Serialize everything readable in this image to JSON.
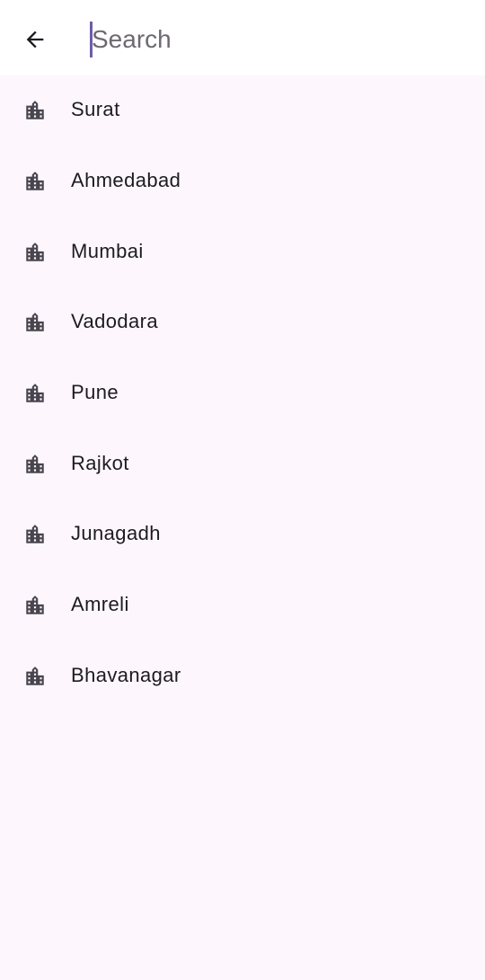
{
  "search": {
    "placeholder": "Search",
    "value": ""
  },
  "results": [
    {
      "label": "Surat",
      "icon": "city-icon"
    },
    {
      "label": "Ahmedabad",
      "icon": "city-icon"
    },
    {
      "label": "Mumbai",
      "icon": "city-icon"
    },
    {
      "label": "Vadodara",
      "icon": "city-icon"
    },
    {
      "label": "Pune",
      "icon": "city-icon"
    },
    {
      "label": "Rajkot",
      "icon": "city-icon"
    },
    {
      "label": "Junagadh",
      "icon": "city-icon"
    },
    {
      "label": "Amreli",
      "icon": "city-icon"
    },
    {
      "label": "Bhavanagar",
      "icon": "city-icon"
    }
  ],
  "icons": {
    "back": "arrow-back-icon",
    "city": "location-city-icon"
  },
  "colors": {
    "background": "#fdf7fd",
    "header": "#ffffff",
    "accent": "#6e5ca8",
    "text": "#1d1b20",
    "icon": "#49454f"
  }
}
